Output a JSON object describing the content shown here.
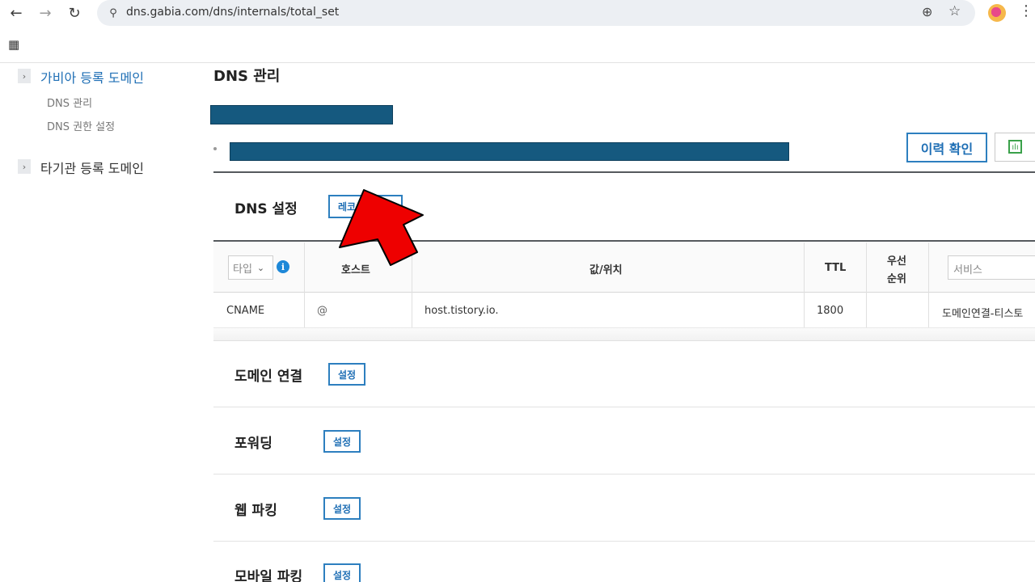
{
  "browser": {
    "url": "dns.gabia.com/dns/internals/total_set",
    "back_glyph": "←",
    "forward_glyph": "→",
    "reload_glyph": "↻",
    "site_info_glyph": "⚲",
    "zoom_glyph": "⊕",
    "star_glyph": "☆",
    "menu_glyph": "⋮",
    "apps_glyph": "▦"
  },
  "sidebar": {
    "chevron_glyph": "›",
    "sections": [
      {
        "label": "가비아 등록 도메인",
        "items": [
          "DNS 관리",
          "DNS 권한 설정"
        ]
      },
      {
        "label": "타기관 등록 도메인",
        "items": []
      }
    ]
  },
  "main": {
    "title": "DNS 관리",
    "history_button": "이력 확인",
    "stats_button_glyph": "ılı",
    "dns_settings": {
      "title": "DNS 설정",
      "record_button": "레코"
    },
    "table": {
      "type_placeholder": "타입",
      "type_chevron": "⌄",
      "info_glyph": "i",
      "headers": {
        "host": "호스트",
        "value": "값/위치",
        "ttl": "TTL",
        "priority_line1": "우선",
        "priority_line2": "순위",
        "service_placeholder": "서비스"
      },
      "rows": [
        {
          "type": "CNAME",
          "host": "@",
          "value": "host.tistory.io.",
          "ttl": "1800",
          "priority": "",
          "service": "도메인연결-티스토"
        }
      ]
    },
    "sections": [
      {
        "title": "도메인 연결",
        "button": "설정"
      },
      {
        "title": "포워딩",
        "button": "설정"
      },
      {
        "title": "웹 파킹",
        "button": "설정"
      },
      {
        "title": "모바일 파킹",
        "button": "설정"
      }
    ]
  },
  "colors": {
    "accent": "#1f6fb5",
    "redaction": "#15597f",
    "arrow": "#ee0000"
  }
}
